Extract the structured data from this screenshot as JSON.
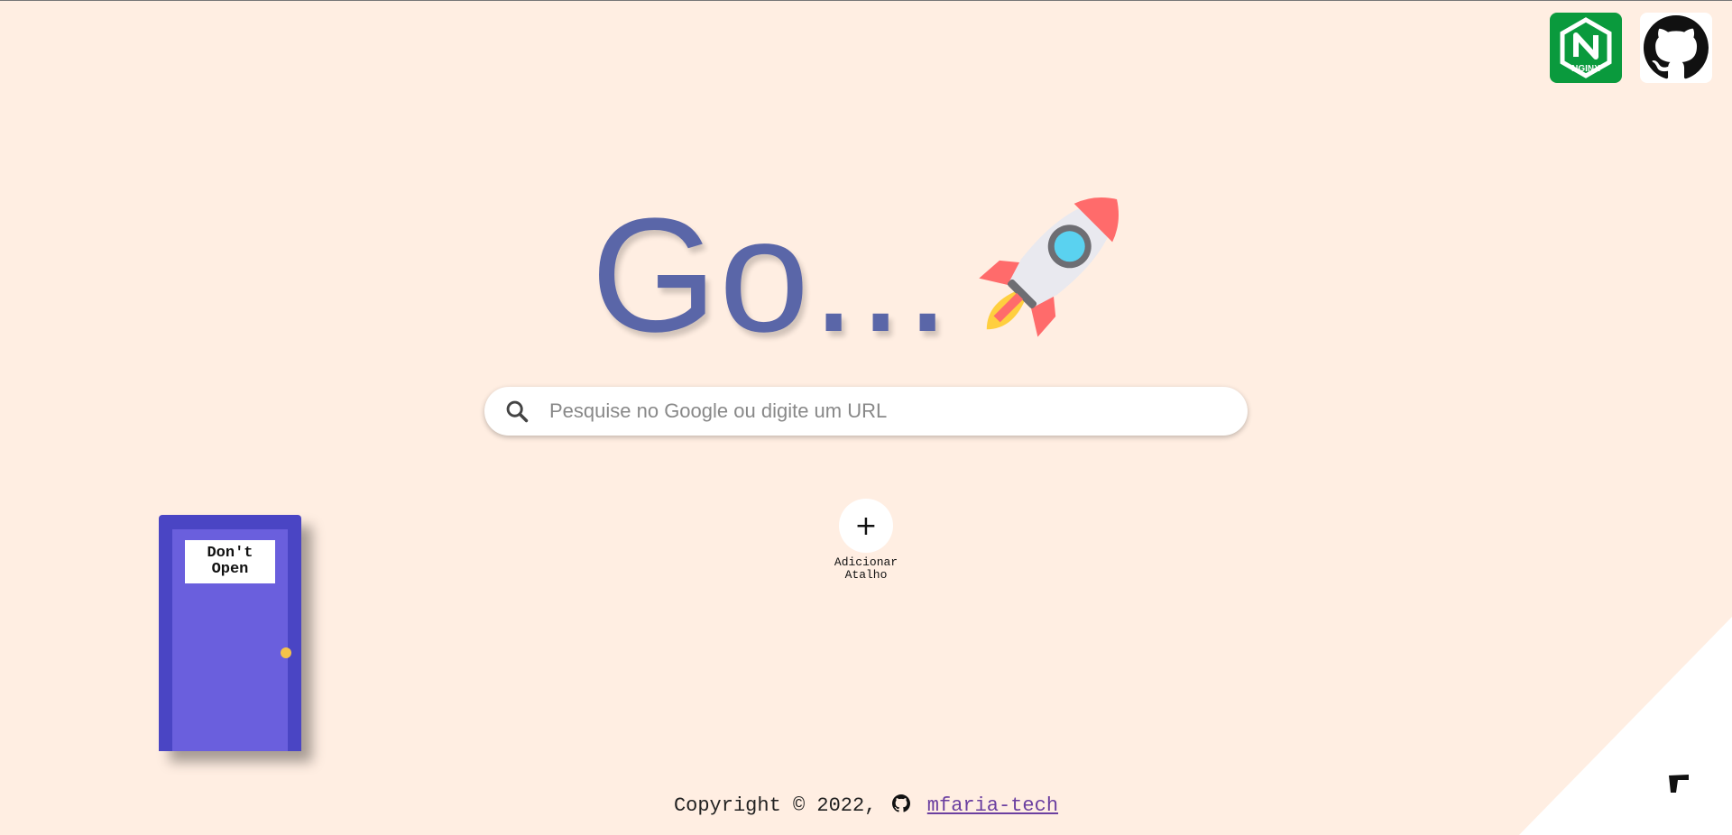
{
  "corner_icons": [
    {
      "name": "nginx-icon",
      "label": "NGINX",
      "color": "#0a9a3d"
    },
    {
      "name": "github-icon",
      "color": "#111111"
    }
  ],
  "hero": {
    "title": "Go...",
    "icon": "rocket-icon"
  },
  "search": {
    "placeholder": "Pesquise no Google ou digite um URL",
    "value": "",
    "icon": "search-icon"
  },
  "shortcut": {
    "symbol": "+",
    "label": "Adicionar\nAtalho"
  },
  "door": {
    "sign": "Don't\nOpen",
    "color": "#6a5fdd",
    "knob_color": "#f5c24a"
  },
  "footer": {
    "copyright": "Copyright © 2022,",
    "link_text": "mfaria-tech"
  },
  "colors": {
    "background": "#ffeee2",
    "title": "#5a66a8"
  }
}
